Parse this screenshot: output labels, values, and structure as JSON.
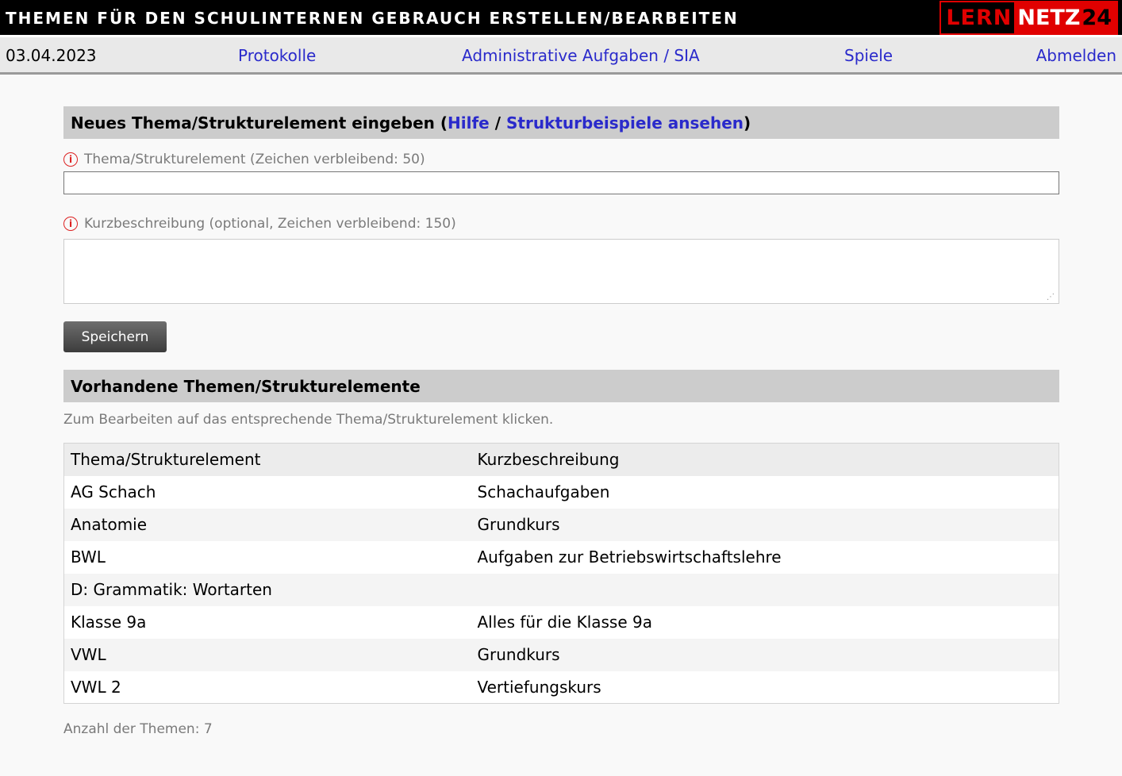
{
  "header": {
    "title": "THEMEN FÜR DEN SCHULINTERNEN GEBRAUCH ERSTELLEN/BEARBEITEN",
    "logo_part1": "LERN",
    "logo_part2": "NETZ",
    "logo_part3": "24"
  },
  "nav": {
    "date": "03.04.2023",
    "protocols": "Protokolle",
    "admin": "Administrative Aufgaben / SIA",
    "games": "Spiele",
    "logout": "Abmelden"
  },
  "new_topic": {
    "heading": "Neues Thema/Strukturelement eingeben",
    "paren_open": "(",
    "help_link": "Hilfe",
    "separator": "/",
    "examples_link": "Strukturbeispiele ansehen",
    "paren_close": ")",
    "topic_label": "Thema/Strukturelement (Zeichen verbleibend: 50)",
    "topic_value": "",
    "desc_label": "Kurzbeschreibung (optional, Zeichen verbleibend: 150)",
    "desc_value": "",
    "save_label": "Speichern"
  },
  "existing": {
    "heading": "Vorhandene Themen/Strukturelemente",
    "hint": "Zum Bearbeiten auf das entsprechende Thema/Strukturelement klicken.",
    "columns": [
      "Thema/Strukturelement",
      "Kurzbeschreibung"
    ],
    "rows": [
      [
        "AG Schach",
        "Schachaufgaben"
      ],
      [
        "Anatomie",
        "Grundkurs"
      ],
      [
        "BWL",
        "Aufgaben zur Betriebswirtschaftslehre"
      ],
      [
        "D: Grammatik: Wortarten",
        ""
      ],
      [
        "Klasse 9a",
        "Alles für die Klasse 9a"
      ],
      [
        "VWL",
        "Grundkurs"
      ],
      [
        "VWL 2",
        "Vertiefungskurs"
      ]
    ],
    "count_label": "Anzahl der Themen: 7"
  },
  "colors": {
    "link": "#2a2acb",
    "logo_red": "#e00000",
    "info_icon": "#dd2222"
  }
}
